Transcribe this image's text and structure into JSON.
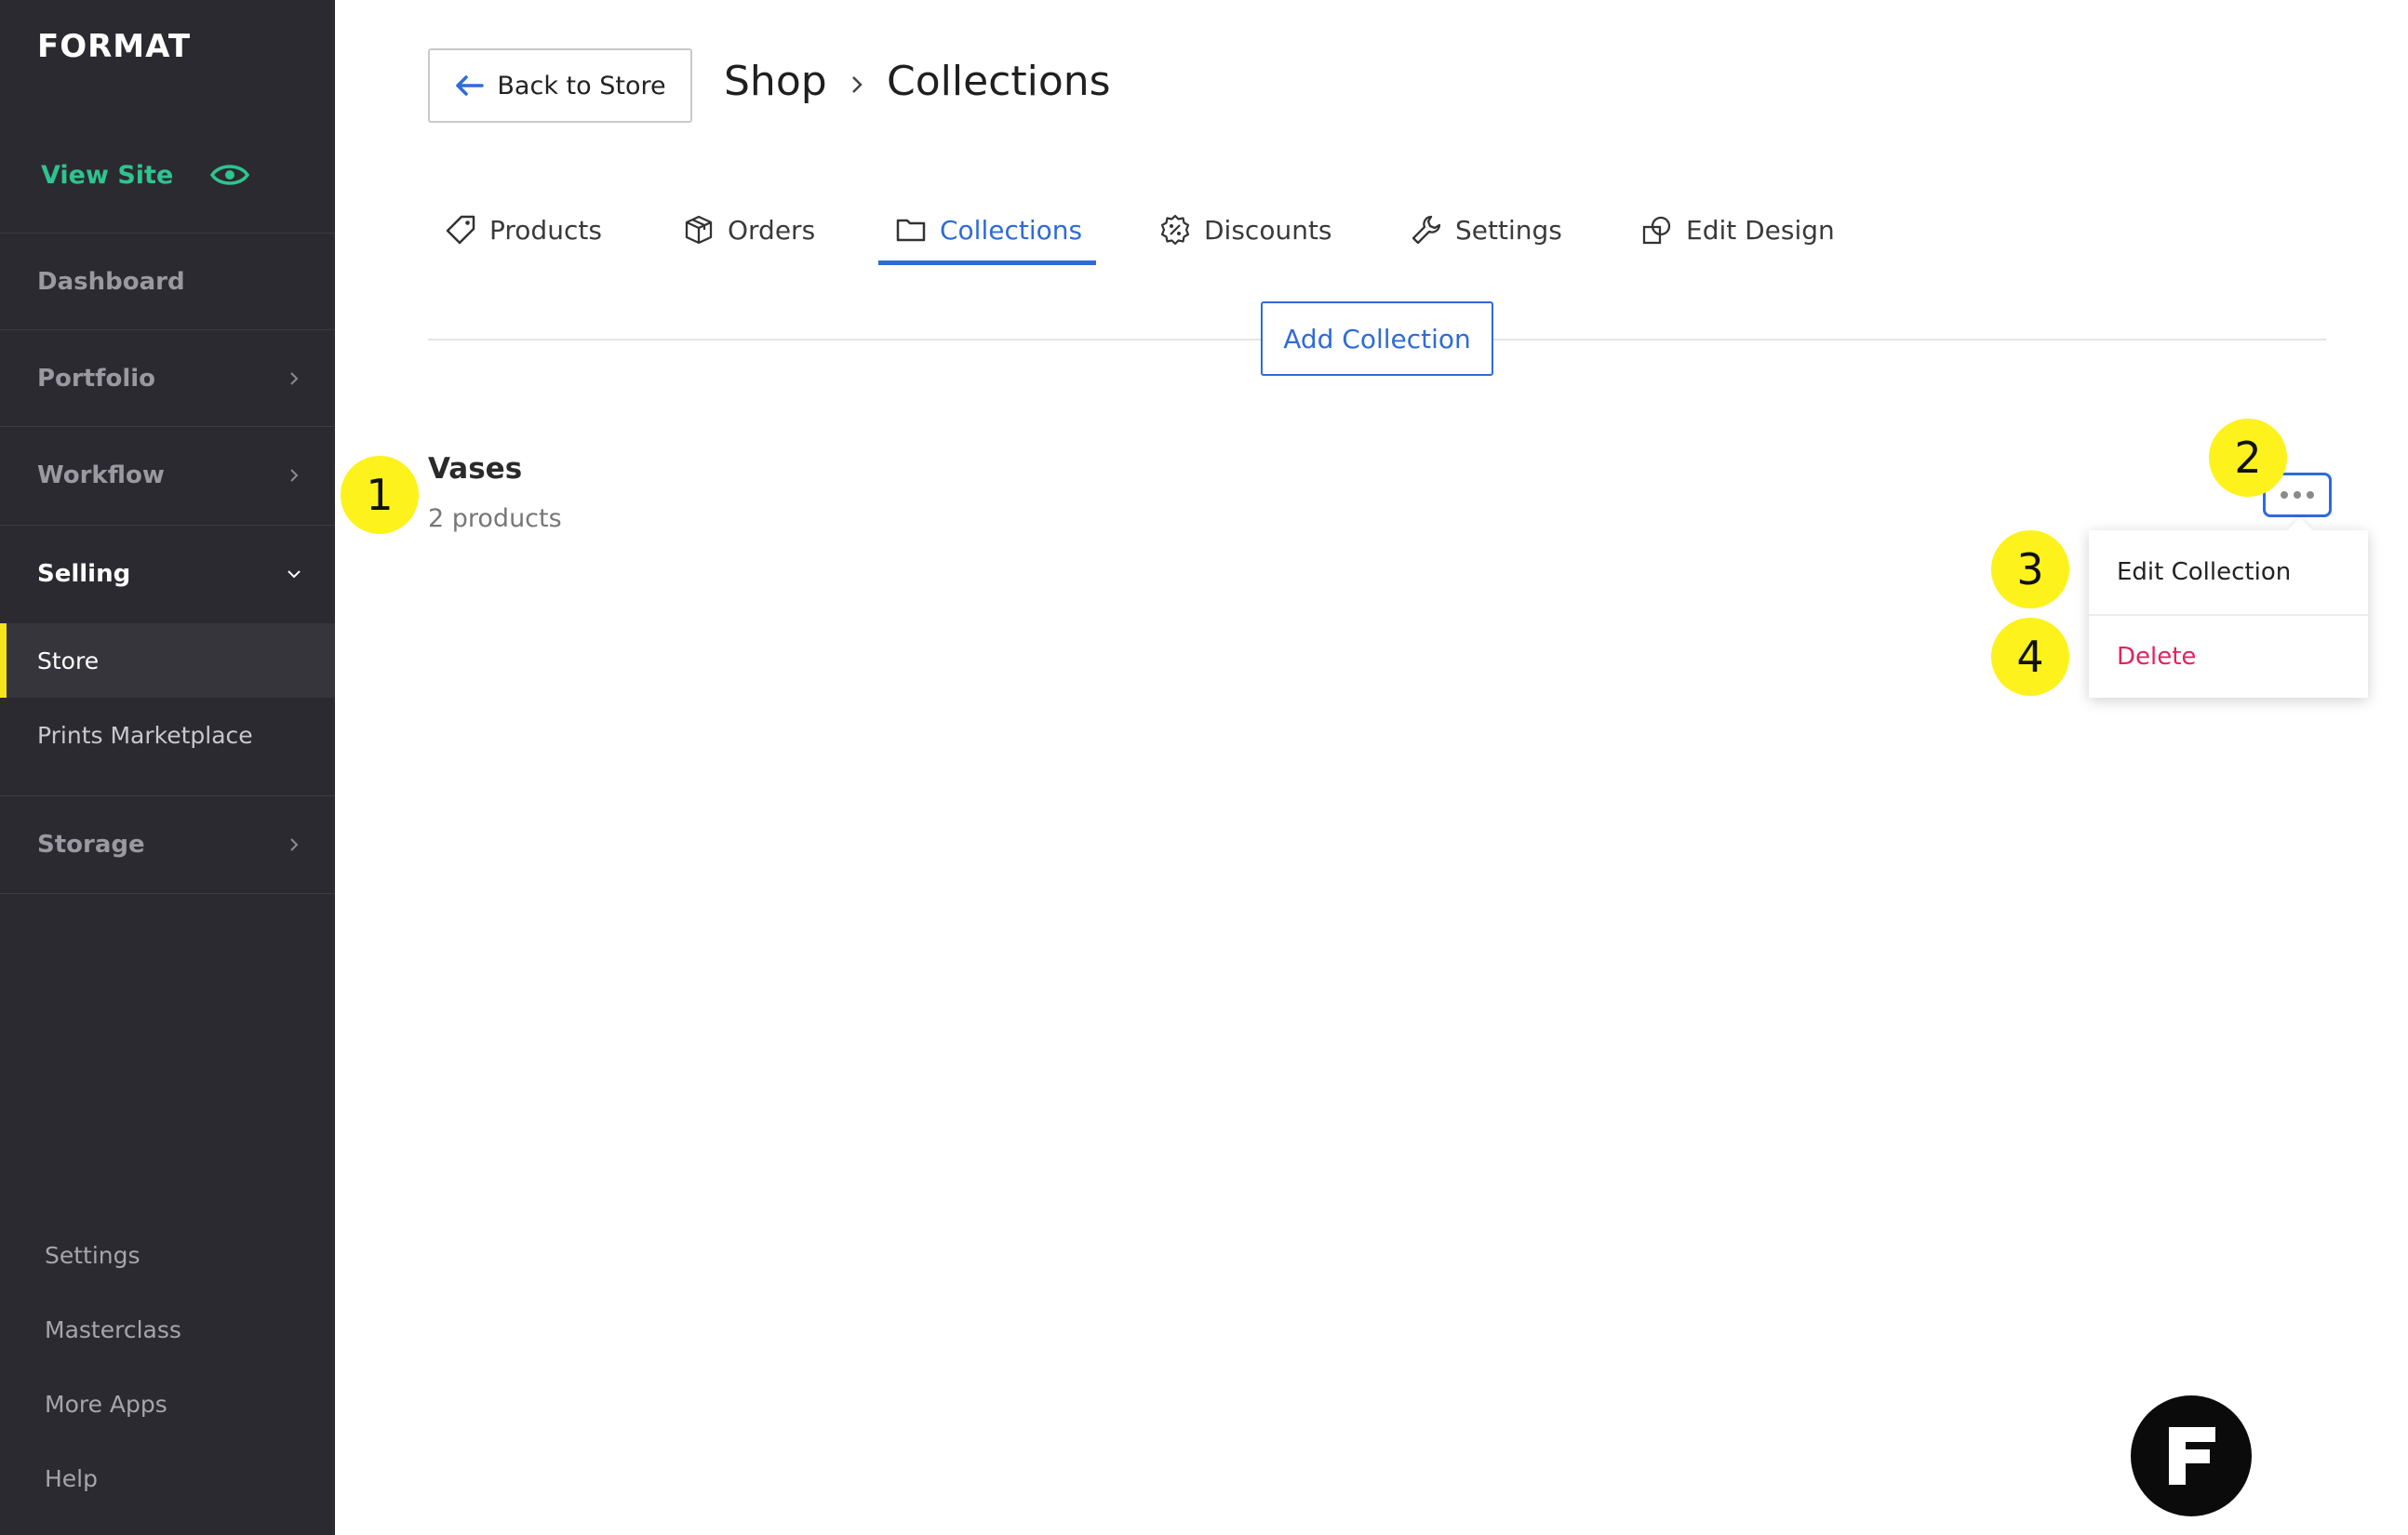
{
  "sidebar": {
    "logo": "FORMAT",
    "view_site": "View Site",
    "items": [
      {
        "label": "Dashboard"
      },
      {
        "label": "Portfolio"
      },
      {
        "label": "Workflow"
      },
      {
        "label": "Selling"
      },
      {
        "label": "Storage"
      }
    ],
    "selling_sub": [
      {
        "label": "Store"
      },
      {
        "label": "Prints Marketplace"
      }
    ],
    "bottom": [
      {
        "label": "Settings"
      },
      {
        "label": "Masterclass"
      },
      {
        "label": "More Apps"
      },
      {
        "label": "Help"
      }
    ]
  },
  "header": {
    "back_label": "Back to Store",
    "breadcrumb": [
      "Shop",
      "Collections"
    ]
  },
  "tabs": [
    {
      "label": "Products"
    },
    {
      "label": "Orders"
    },
    {
      "label": "Collections",
      "active": true
    },
    {
      "label": "Discounts"
    },
    {
      "label": "Settings"
    },
    {
      "label": "Edit Design"
    }
  ],
  "add_collection_label": "Add Collection",
  "collection": {
    "name": "Vases",
    "count": "2 products"
  },
  "menu": {
    "edit": "Edit Collection",
    "delete": "Delete"
  },
  "callouts": [
    "1",
    "2",
    "3",
    "4"
  ],
  "fab_letter": "F",
  "colors": {
    "accent": "#2f6bd6",
    "danger": "#e0245e",
    "highlight": "#fdf21b",
    "sidebar": "#2b2a30",
    "view_site": "#2ec48e"
  }
}
